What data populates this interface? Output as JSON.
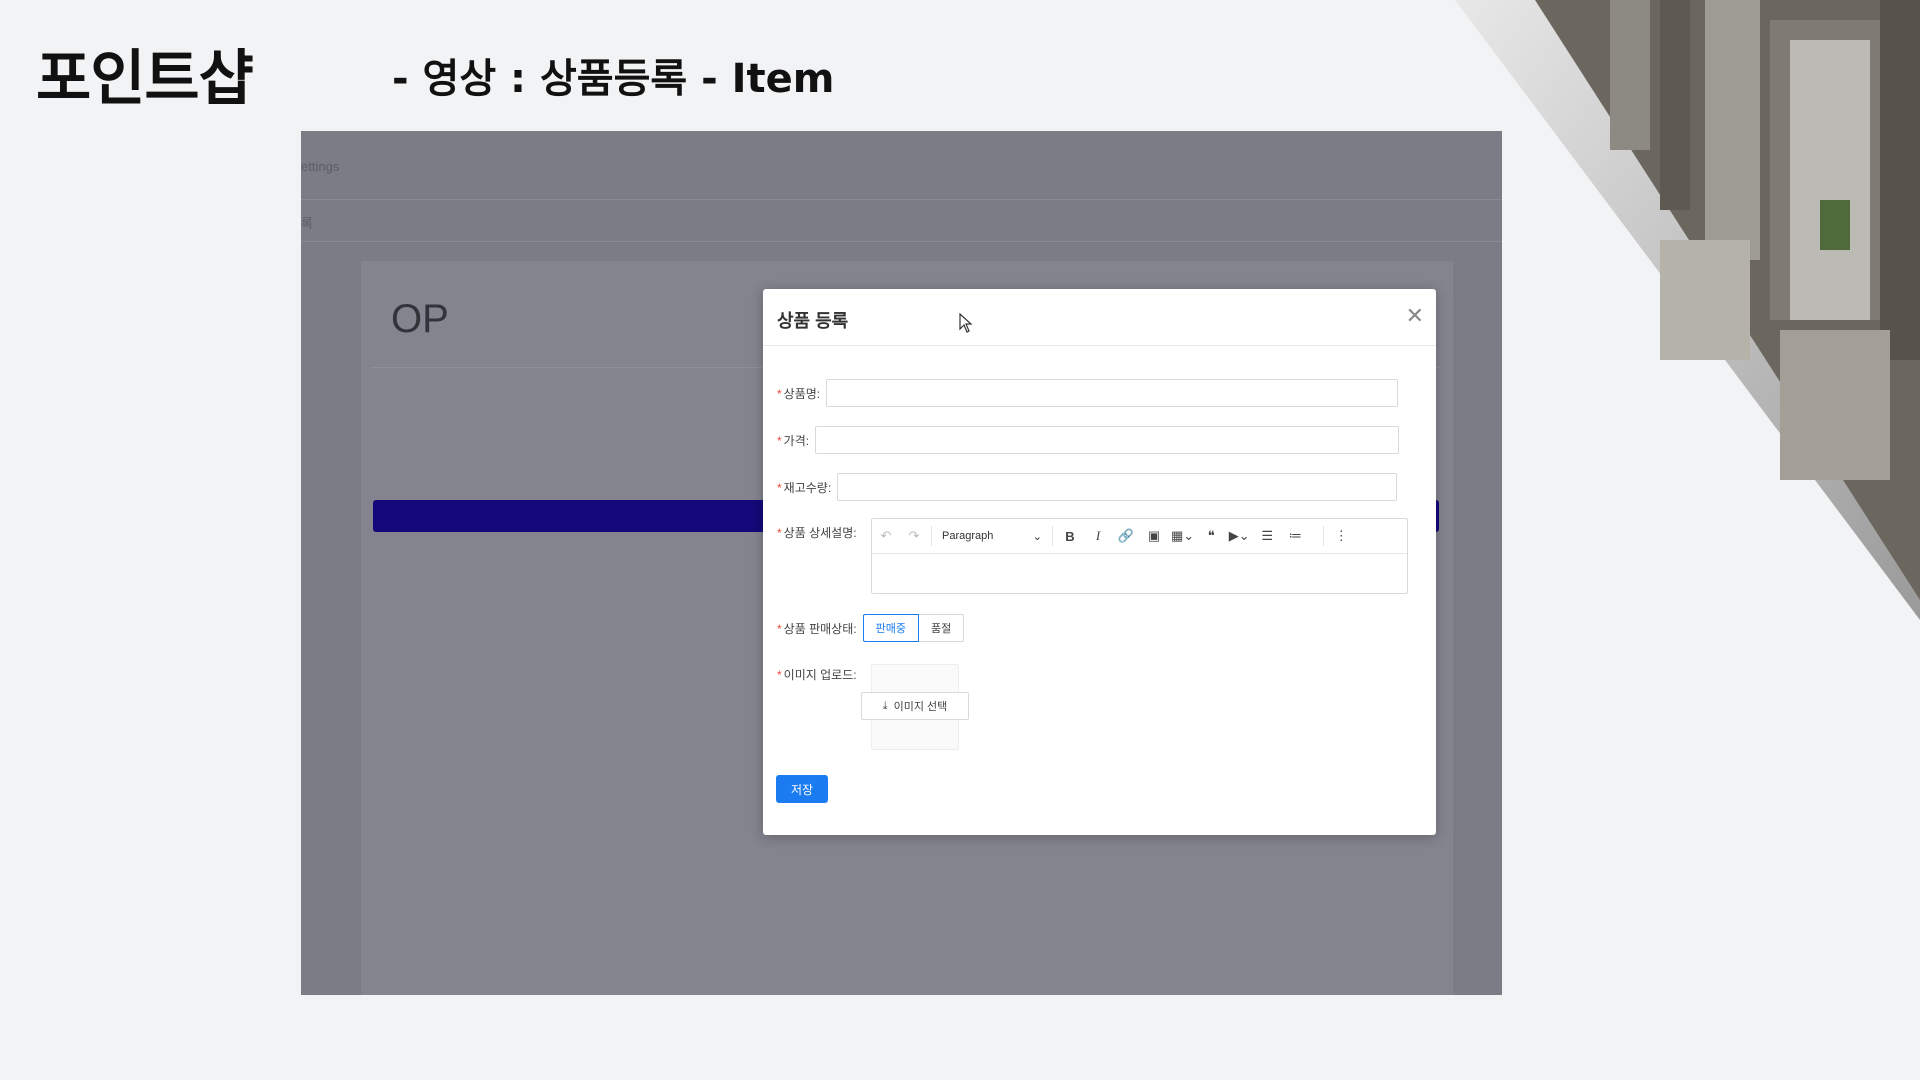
{
  "slide": {
    "title": "포인트샵",
    "subtitle": "- 영상 : 상품등록 - Item"
  },
  "background_app": {
    "menu_fragment": "ettings",
    "breadcrumb_fragment": "록",
    "page_heading": "OP",
    "banner_color": "#14087a"
  },
  "modal": {
    "title": "상품 등록",
    "close_icon": "close-icon",
    "fields": {
      "name_label": "상품명:",
      "price_label": "가격:",
      "stock_label": "재고수량:",
      "detail_label": "상품 상세설명:",
      "status_label": "상품 판매상태:",
      "image_label": "이미지 업로드:"
    },
    "editor": {
      "paragraph_select": "Paragraph",
      "bold": "B",
      "italic": "I"
    },
    "status_options": [
      "판매중",
      "품절"
    ],
    "status_selected": "판매중",
    "upload_button": "이미지 선택",
    "save_button": "저장"
  },
  "colors": {
    "accent": "#1a7cf0",
    "required": "#e84c3d",
    "overlay": "#7c7c87"
  }
}
